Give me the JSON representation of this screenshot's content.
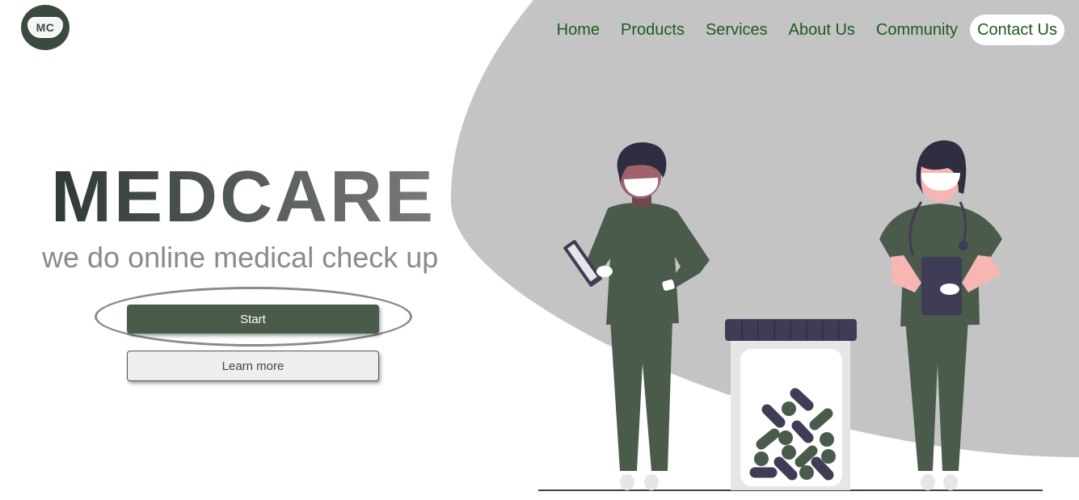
{
  "brand": {
    "logo_text": "MC",
    "logo_icon": "mc-mask-logo-icon"
  },
  "nav": {
    "items": [
      {
        "label": "Home"
      },
      {
        "label": "Products"
      },
      {
        "label": "Services"
      },
      {
        "label": "About Us"
      },
      {
        "label": "Community"
      },
      {
        "label": "Contact Us",
        "active": true
      }
    ]
  },
  "hero": {
    "title": "MEDCARE",
    "subtitle": "we do online medical check up",
    "start_label": "Start",
    "learn_more_label": "Learn more"
  },
  "colors": {
    "primary_green": "#4a5a4b",
    "nav_text": "#1f5a1f",
    "blob_gray": "#c4c4c4",
    "dark_navy": "#3f3d56",
    "skin_pink": "#f7b5b3"
  },
  "illustration": {
    "name": "two-doctors-with-pill-jar-illustration"
  }
}
